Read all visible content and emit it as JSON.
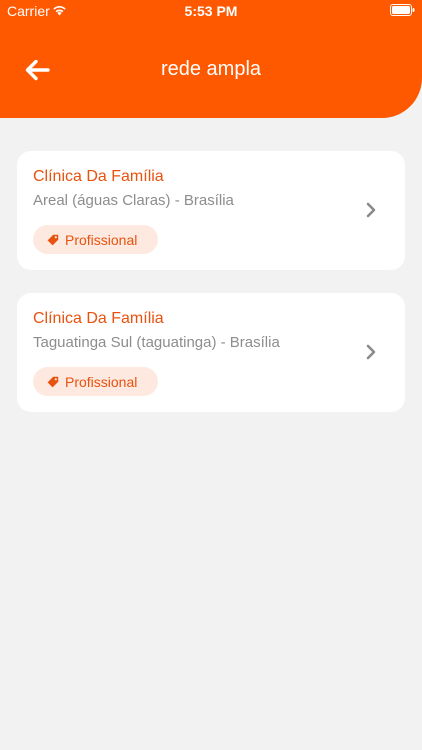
{
  "status_bar": {
    "carrier": "Carrier",
    "time": "5:53 PM",
    "wifi_icon": "wifi-icon",
    "battery_icon": "battery-icon"
  },
  "header": {
    "title": "rede ampla",
    "back_icon": "arrow-left-icon",
    "color": "#fe5801"
  },
  "results": [
    {
      "title": "Clínica Da Família",
      "location": "Areal (águas Claras) - Brasília",
      "tag": "Profissional",
      "tag_icon": "tag-icon",
      "chevron_icon": "chevron-right-icon"
    },
    {
      "title": "Clínica Da Família",
      "location": "Taguatinga Sul (taguatinga) - Brasília",
      "tag": "Profissional",
      "tag_icon": "tag-icon",
      "chevron_icon": "chevron-right-icon"
    }
  ],
  "colors": {
    "accent": "#fe5801",
    "title_text": "#e8520f",
    "tag_background": "#fde9df",
    "page_background": "#f2f2f2"
  }
}
